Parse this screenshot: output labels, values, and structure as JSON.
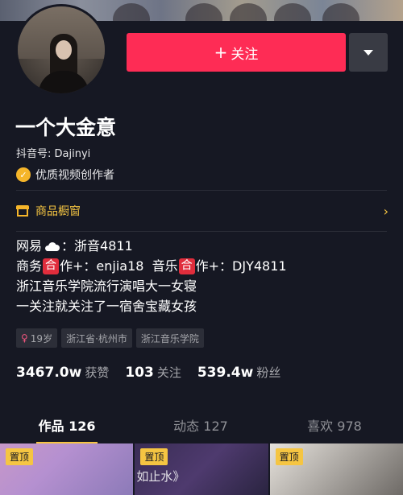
{
  "profile": {
    "name": "一个大金意",
    "douyin_id": "抖音号: Dajinyi",
    "verification": "优质视频创作者"
  },
  "actions": {
    "follow_label": "关注",
    "follow_plus": "+",
    "colors": {
      "follow": "#fe2c55",
      "more": "#393b44",
      "accent": "#f5c542"
    }
  },
  "shop": {
    "label": "商品橱窗"
  },
  "bio": {
    "line1_a": "网易",
    "line1_b": "：浙音4811",
    "line2_a": "商务",
    "line2_b": "作+：enjia18  音乐",
    "line2_c": "作+：DJY4811",
    "he_char": "合",
    "line3": "浙江音乐学院流行演唱大一女寝",
    "line4": "一关注就关注了一宿舍宝藏女孩"
  },
  "tags": {
    "age": "19岁",
    "location": "浙江省·杭州市",
    "school": "浙江音乐学院"
  },
  "stats": {
    "likes_num": "3467.0w",
    "likes_label": "获赞",
    "following_num": "103",
    "following_label": "关注",
    "fans_num": "539.4w",
    "fans_label": "粉丝"
  },
  "tabs": [
    {
      "label": "作品 126"
    },
    {
      "label": "动态 127"
    },
    {
      "label": "喜欢 978"
    }
  ],
  "videos": [
    {
      "pin": "置顶"
    },
    {
      "pin": "置顶",
      "caption": "如止水》"
    },
    {
      "pin": "置顶"
    }
  ]
}
